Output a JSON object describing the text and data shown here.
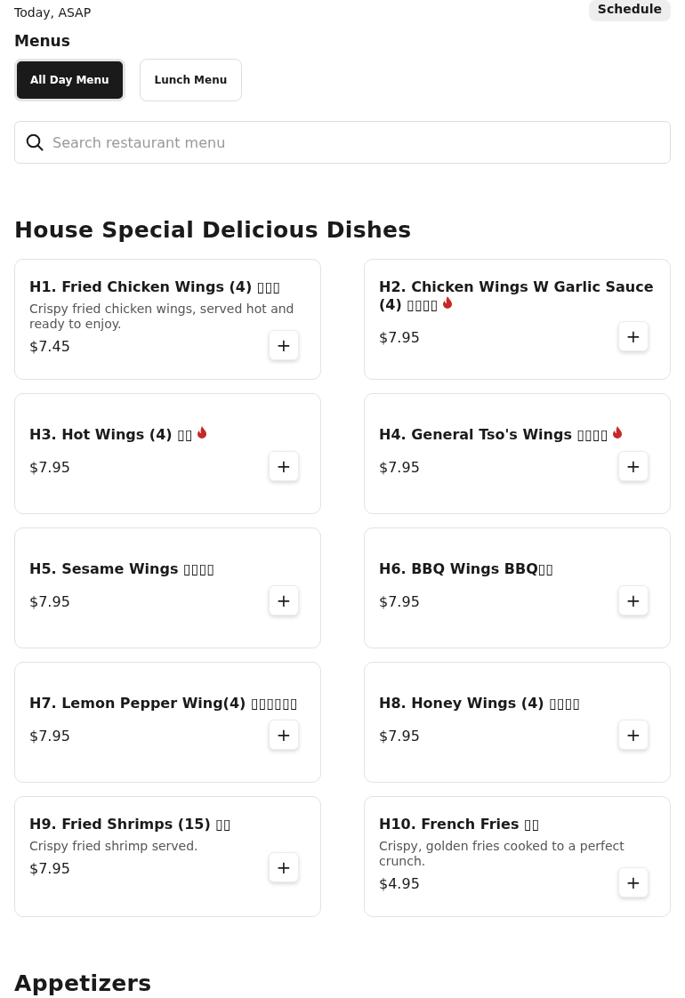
{
  "order": {
    "time": "Today, ASAP",
    "schedule_button": "Schedule"
  },
  "menus": {
    "heading": "Menus",
    "tabs": [
      {
        "label": "All Day Menu",
        "selected": true
      },
      {
        "label": "Lunch Menu",
        "selected": false
      }
    ]
  },
  "search": {
    "placeholder": "Search restaurant menu"
  },
  "sections": [
    {
      "title": "House Special Delicious Dishes",
      "items": [
        {
          "name": "H1. Fried Chicken Wings (4) ▯▯▯",
          "spicy": false,
          "description": "Crispy fried chicken wings, served hot and ready to enjoy.",
          "price": "$7.45",
          "add": "+"
        },
        {
          "name": "H2. Chicken Wings W Garlic Sauce (4) ▯▯▯▯",
          "spicy": true,
          "price": "$7.95",
          "add": "+"
        },
        {
          "name": "H3. Hot Wings (4) ▯▯",
          "spicy": true,
          "price": "$7.95",
          "add": "+"
        },
        {
          "name": "H4. General Tso's Wings ▯▯▯▯",
          "spicy": true,
          "price": "$7.95",
          "add": "+"
        },
        {
          "name": "H5. Sesame Wings ▯▯▯▯",
          "spicy": false,
          "price": "$7.95",
          "add": "+"
        },
        {
          "name": "H6. BBQ Wings BBQ▯▯",
          "spicy": false,
          "price": "$7.95",
          "add": "+"
        },
        {
          "name": "H7. Lemon Pepper Wing(4) ▯▯▯▯▯▯",
          "spicy": false,
          "price": "$7.95",
          "add": "+"
        },
        {
          "name": "H8. Honey Wings (4) ▯▯▯▯",
          "spicy": false,
          "price": "$7.95",
          "add": "+"
        },
        {
          "name": "H9. Fried Shrimps (15) ▯▯",
          "spicy": false,
          "description": "Crispy fried shrimp served.",
          "price": "$7.95",
          "add": "+"
        },
        {
          "name": "H10. French Fries ▯▯",
          "spicy": false,
          "description": "Crispy, golden fries cooked to a perfect crunch.",
          "price": "$4.95",
          "add": "+"
        }
      ]
    },
    {
      "title": "Appetizers"
    }
  ]
}
